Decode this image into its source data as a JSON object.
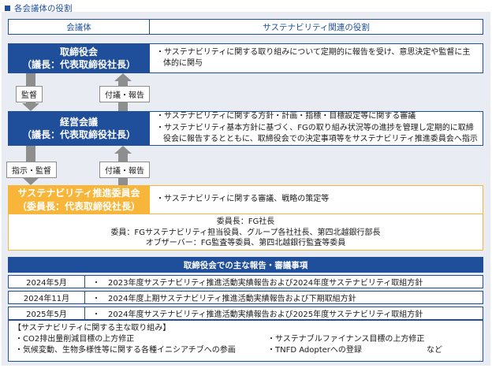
{
  "section_title": "各会議体の役割",
  "header": {
    "left": "会議体",
    "right": "サステナビリティ関連の役割"
  },
  "board": {
    "name": "取締役会",
    "chair": "（議長：代表取締役社長）",
    "roles": [
      "サステナビリティに関する取り組みについて定期的に報告を受け、意思決定や監督に主体的に関与"
    ]
  },
  "arrows1": {
    "down_label": "監督",
    "up_label": "付議・報告"
  },
  "mgmt": {
    "name": "経営会議",
    "chair": "（議長：代表取締役社長）",
    "roles": [
      "サステナビリティに関する方針・計画・指標・目標設定等に関する審議",
      "サステナビリティ基本方針に基づく、FGの取り組み状況等の進捗を管理し定期的に取締役会に報告するとともに、取締役会での決定事項等をサステナビリティ推進委員会へ指示"
    ]
  },
  "arrows2": {
    "down_label": "指示・監督",
    "up_label": "付議・報告"
  },
  "sus": {
    "name": "サステナビリティ推進委員会",
    "chair": "（委員長：代表取締役社長）",
    "roles": [
      "サステナビリティに関する審議、戦略の策定等"
    ]
  },
  "members": {
    "line1": "委員長：FG社長",
    "line2": "委員：FGサステナビリティ担当役員、グループ各社社長、第四北越銀行部長",
    "line3": "オブザーバー：FG監査等委員、第四北越銀行監査等委員"
  },
  "meetings": {
    "title": "取締役会での主な報告・審議事項",
    "rows": [
      {
        "date": "2024年5月",
        "text": "・　2023年度サステナビリティ推進活動実績報告および2024年度サステナビリティ取組方針"
      },
      {
        "date": "2024年11月",
        "text": "・　2024年度上期サステナビリティ推進活動実績報告および下期取組方針"
      },
      {
        "date": "2025年5月",
        "text": "・　2024年度サステナビリティ推進活動実績報告および2025年度サステナビリティ取組方針"
      }
    ]
  },
  "initiatives": {
    "title": "【サステナビリティに関する主な取り組み】",
    "items": [
      "・CO2排出量削減目標の上方修正",
      "・サステナブルファイナンス目標の上方修正",
      "・気候変動、生物多様性等に関する各種イニシアチブへの参画",
      "・TNFD Adopterへの登録"
    ],
    "etc": "など"
  },
  "colors": {
    "navy": "#1f4e9a",
    "orange": "#f7b53a",
    "arrow_gray": "#8e8e8e",
    "panel_bg": "#e9ecf3"
  }
}
